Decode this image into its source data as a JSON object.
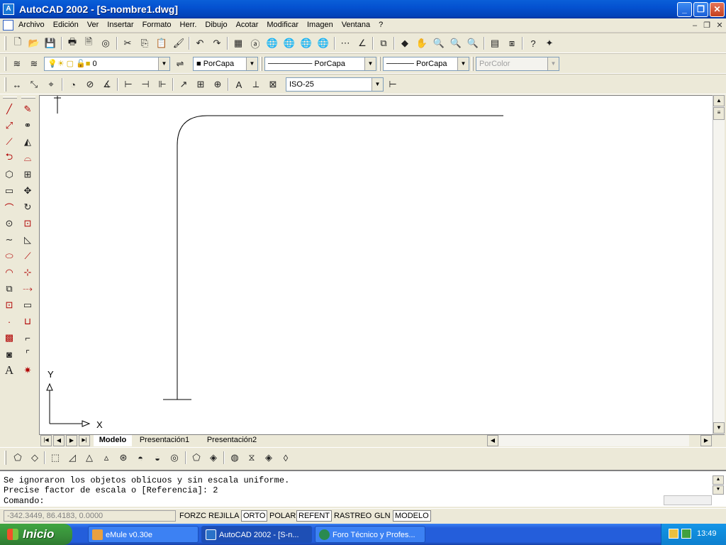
{
  "window": {
    "title": "AutoCAD 2002 - [S-nombre1.dwg]"
  },
  "menu": [
    "Archivo",
    "Edición",
    "Ver",
    "Insertar",
    "Formato",
    "Herr.",
    "Dibujo",
    "Acotar",
    "Modificar",
    "Imagen",
    "Ventana",
    "?"
  ],
  "properties_toolbar": {
    "layer": "0",
    "color": "PorCapa",
    "linetype": "PorCapa",
    "lineweight": "PorCapa",
    "plotstyle": "PorColor"
  },
  "dimension_toolbar": {
    "dimstyle": "ISO-25"
  },
  "axes": {
    "x": "X",
    "y": "Y"
  },
  "tabs": [
    "Modelo",
    "Presentación1",
    "Presentación2"
  ],
  "command": {
    "line1": "Se ignoraron los objetos oblicuos y sin escala uniforme.",
    "line2": "Precise factor de escala o [Referencia]: 2",
    "prompt": "Comando:"
  },
  "status": {
    "coords": "-342.3449, 86.4183, 0.0000",
    "buttons": [
      "FORZC",
      "REJILLA",
      "ORTO",
      "POLAR",
      "REFENT",
      "RASTREO",
      "GLN",
      "MODELO"
    ]
  },
  "taskbar": {
    "start": "Inicio",
    "tasks": [
      "eMule v0.30e",
      "AutoCAD 2002 - [S-n...",
      "Foro Técnico y Profes..."
    ],
    "clock": "13:49"
  },
  "colors": {
    "titlebar": "#0451d0",
    "taskbar": "#245edb",
    "start": "#388e3a"
  }
}
